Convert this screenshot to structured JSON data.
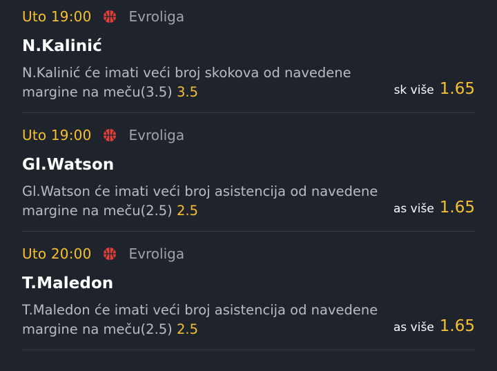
{
  "bets": [
    {
      "time": "Uto 19:00",
      "league": "Evroliga",
      "sport_icon": "basketball-icon",
      "player": "N.Kalinić",
      "description": "N.Kalinić će imati veći broj skokova od navedene margine na meču(3.5)",
      "margin": "3.5",
      "pick": "sk više",
      "odds": "1.65"
    },
    {
      "time": "Uto 19:00",
      "league": "Evroliga",
      "sport_icon": "basketball-icon",
      "player": "Gl.Watson",
      "description": "Gl.Watson će imati veći broj asistencija od navedene margine na meču(2.5)",
      "margin": "2.5",
      "pick": "as više",
      "odds": "1.65"
    },
    {
      "time": "Uto 20:00",
      "league": "Evroliga",
      "sport_icon": "basketball-icon",
      "player": "T.Maledon",
      "description": "T.Maledon će imati veći broj asistencija od navedene margine na meču(2.5)",
      "margin": "2.5",
      "pick": "as više",
      "odds": "1.65"
    }
  ],
  "colors": {
    "background": "#1f232c",
    "accent": "#f6c02e",
    "muted": "#9ea3ad",
    "ball": "#e0403a"
  }
}
